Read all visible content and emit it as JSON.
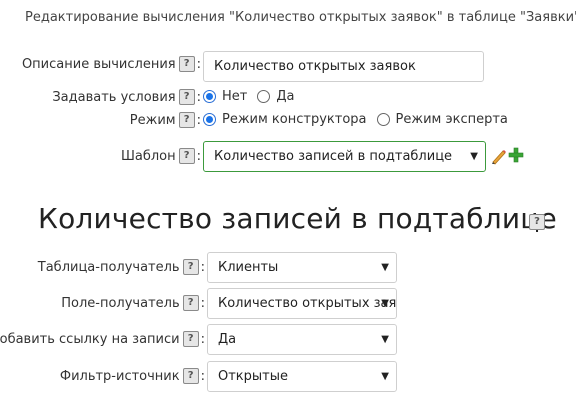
{
  "header": {
    "title": "Редактирование вычисления \"Количество открытых заявок\" в таблице \"Заявки\""
  },
  "help_glyph": "?",
  "colon": ":",
  "form": {
    "description": {
      "label": "Описание вычисления",
      "value": "Количество открытых заявок"
    },
    "conditions": {
      "label": "Задавать условия",
      "options": [
        {
          "label": "Нет",
          "selected": true
        },
        {
          "label": "Да",
          "selected": false
        }
      ]
    },
    "mode": {
      "label": "Режим",
      "options": [
        {
          "label": "Режим конструктора",
          "selected": true
        },
        {
          "label": "Режим эксперта",
          "selected": false
        }
      ]
    },
    "template": {
      "label": "Шаблон",
      "value": "Количество записей в подтаблице",
      "edit_icon": "pencil-icon",
      "add_icon": "plus-icon"
    }
  },
  "section": {
    "title": "Количество записей в подтаблице",
    "fields": [
      {
        "label": "Таблица-получатель",
        "value": "Клиенты"
      },
      {
        "label": "Поле-получатель",
        "value": "Количество открытых зая"
      },
      {
        "label": "Добавить ссылку на записи",
        "value": "Да"
      },
      {
        "label": "Фильтр-источник",
        "value": "Открытые"
      }
    ]
  },
  "colors": {
    "accent_green": "#3c9a3c",
    "radio_blue": "#1a73e8",
    "plus_green": "#39a535",
    "pencil_orange": "#e8a33a"
  }
}
